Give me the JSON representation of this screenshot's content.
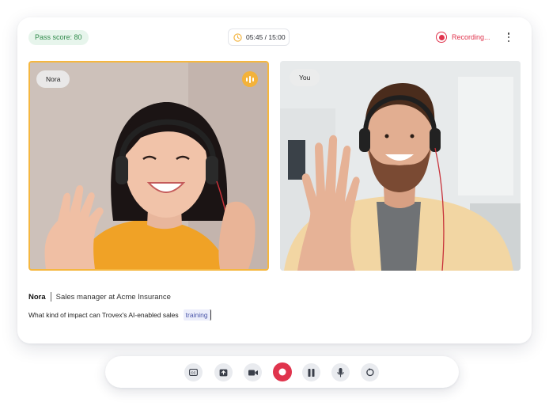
{
  "header": {
    "pass_score": "Pass score: 80",
    "timer": "05:45 / 15:00",
    "recording_label": "Recording..."
  },
  "participants": [
    {
      "label": "Nora",
      "speaking": true
    },
    {
      "label": "You",
      "speaking": false
    }
  ],
  "transcript": {
    "speaker": "Nora",
    "role": "Sales manager at Acme Insurance",
    "text": "What kind of impact can Trovex's AI-enabled sales",
    "highlight": "training"
  },
  "controls": {
    "items": [
      "captions-icon",
      "share-screen-icon",
      "camera-icon",
      "record-icon",
      "pause-icon",
      "microphone-icon",
      "restart-icon"
    ]
  },
  "colors": {
    "accent_speaking": "#f3b23a",
    "recording": "#e0344d",
    "pass_badge_bg": "#e7f5ec",
    "pass_badge_text": "#2f8a4a"
  }
}
